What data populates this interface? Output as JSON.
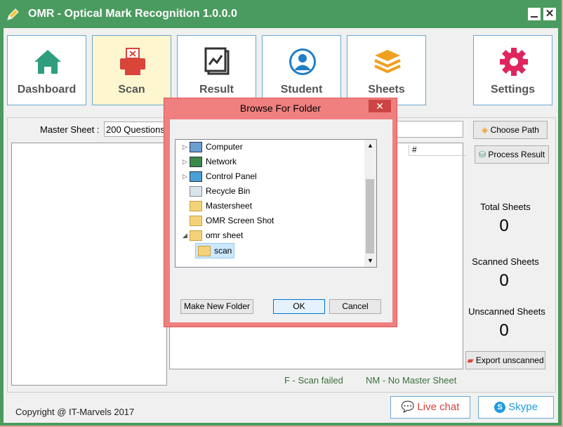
{
  "window": {
    "title": "OMR - Optical Mark Recognition 1.0.0.0"
  },
  "nav": [
    {
      "label": "Dashboard"
    },
    {
      "label": "Scan"
    },
    {
      "label": "Result"
    },
    {
      "label": "Student"
    },
    {
      "label": "Sheets"
    },
    {
      "label": "Settings"
    }
  ],
  "master_sheet": {
    "label": "Master Sheet :",
    "value": "200 Questions"
  },
  "table": {
    "col_hash": "#"
  },
  "actions": {
    "choose_path": "Choose Path",
    "process_result": "Process Result",
    "export_unscanned": "Export unscanned"
  },
  "stats": {
    "total_label": "Total Sheets",
    "total_value": "0",
    "scanned_label": "Scanned Sheets",
    "scanned_value": "0",
    "unscanned_label": "Unscanned Sheets",
    "unscanned_value": "0"
  },
  "legend": {
    "failed": "F - Scan failed",
    "no_master": "NM - No Master Sheet"
  },
  "footer": {
    "copyright": "Copyright @ IT-Marvels 2017",
    "live_chat": "Live chat",
    "skype": "Skype"
  },
  "dialog": {
    "title": "Browse For Folder",
    "tree": [
      {
        "label": "Computer"
      },
      {
        "label": "Network"
      },
      {
        "label": "Control Panel"
      },
      {
        "label": "Recycle Bin"
      },
      {
        "label": "Mastersheet"
      },
      {
        "label": "OMR Screen Shot"
      },
      {
        "label": "omr sheet"
      },
      {
        "label": "scan"
      }
    ],
    "make_new_folder": "Make New Folder",
    "ok": "OK",
    "cancel": "Cancel"
  },
  "colors": {
    "titlebar": "#4a9b5f",
    "accent": "#6ba8cf",
    "dialog": "#f08080",
    "green_icon": "#2e9e7e",
    "red_icon": "#d9443b",
    "blue_icon": "#1e7ec8",
    "orange_icon": "#f0a020",
    "pink_icon": "#e0245e"
  }
}
